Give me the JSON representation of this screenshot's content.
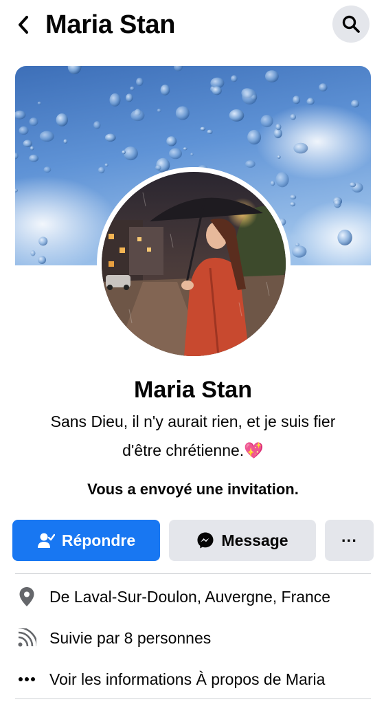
{
  "header": {
    "title": "Maria Stan",
    "back_icon": "chevron-left-icon",
    "search_icon": "search-icon"
  },
  "profile": {
    "name": "Maria Stan",
    "bio_line1": "Sans Dieu, il n'y aurait rien, et je suis fier",
    "bio_line2": "d'être chrétienne.",
    "bio_emoji": "💖",
    "invite_text": "Vous a envoyé une invitation."
  },
  "actions": {
    "respond_label": "Répondre",
    "message_label": "Message",
    "more_label": "···"
  },
  "info": {
    "location": "De Laval-Sur-Doulon, Auvergne, France",
    "followers": "Suivie par 8 personnes",
    "about": "Voir les informations À propos de Maria"
  },
  "colors": {
    "accent": "#1877f2",
    "secondary_button": "#e4e6eb",
    "text": "#050505",
    "icon_gray": "#65676b"
  }
}
